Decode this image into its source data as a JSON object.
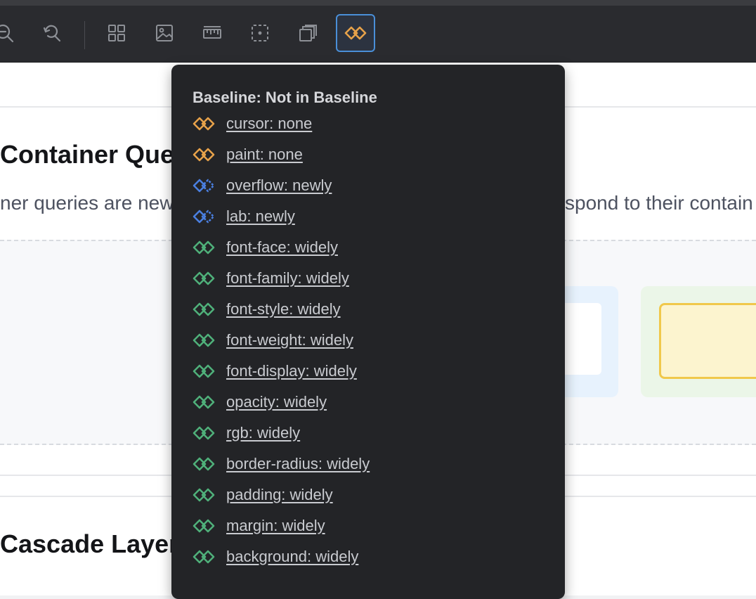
{
  "toolbar": {
    "buttons": [
      {
        "icon": "zoom-out-icon"
      },
      {
        "icon": "reset-zoom-icon"
      },
      {
        "icon": "grid-icon"
      },
      {
        "icon": "image-icon"
      },
      {
        "icon": "ruler-icon"
      },
      {
        "icon": "dashed-select-icon"
      },
      {
        "icon": "layers-icon"
      },
      {
        "icon": "baseline-icon",
        "active": true
      }
    ]
  },
  "page": {
    "section1": {
      "heading": "Container Quer",
      "desc_left": "ner queries are new",
      "desc_right": "spond to their contain"
    },
    "section2": {
      "heading": "Cascade Layer"
    }
  },
  "popover": {
    "title": "Baseline: Not in Baseline",
    "items": [
      {
        "label": "cursor: none",
        "status": "none"
      },
      {
        "label": "paint: none",
        "status": "none"
      },
      {
        "label": "overflow: newly",
        "status": "newly"
      },
      {
        "label": "lab: newly",
        "status": "newly"
      },
      {
        "label": "font-face: widely",
        "status": "widely"
      },
      {
        "label": "font-family: widely",
        "status": "widely"
      },
      {
        "label": "font-style: widely",
        "status": "widely"
      },
      {
        "label": "font-weight: widely",
        "status": "widely"
      },
      {
        "label": "font-display: widely",
        "status": "widely"
      },
      {
        "label": "opacity: widely",
        "status": "widely"
      },
      {
        "label": "rgb: widely",
        "status": "widely"
      },
      {
        "label": "border-radius: widely",
        "status": "widely"
      },
      {
        "label": "padding: widely",
        "status": "widely"
      },
      {
        "label": "margin: widely",
        "status": "widely"
      },
      {
        "label": "background: widely",
        "status": "widely"
      }
    ]
  },
  "colors": {
    "status_none": "#e7a24a",
    "status_newly": "#4a7fe0",
    "status_widely": "#4fb07a",
    "accent": "#4a8fd8"
  }
}
